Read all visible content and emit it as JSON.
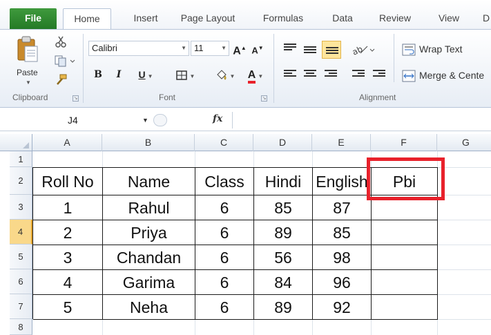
{
  "ribbon_tabs": [
    "File",
    "Home",
    "Insert",
    "Page Layout",
    "Formulas",
    "Data",
    "Review",
    "View",
    "D"
  ],
  "active_tab": "Home",
  "clipboard": {
    "paste_label": "Paste",
    "group_label": "Clipboard"
  },
  "font": {
    "family": "Calibri",
    "size": "11",
    "grow_label": "A",
    "shrink_label": "A",
    "bold": "B",
    "italic": "I",
    "underline": "U",
    "color_label": "A",
    "group_label": "Font"
  },
  "alignment": {
    "wrap_text": "Wrap Text",
    "merge_center": "Merge & Cente",
    "group_label": "Alignment"
  },
  "formula_bar": {
    "name_box": "J4",
    "fx": "fx",
    "value": ""
  },
  "sheet": {
    "columns": [
      "A",
      "B",
      "C",
      "D",
      "E",
      "F",
      "G"
    ],
    "row_numbers": [
      "1",
      "2",
      "3",
      "4",
      "5",
      "6",
      "7",
      "8"
    ],
    "selected_row": "4",
    "headers": [
      "Roll No",
      "Name",
      "Class",
      "Hindi",
      "English",
      "Pbi"
    ],
    "rows": [
      [
        "1",
        "Rahul",
        "6",
        "85",
        "87",
        ""
      ],
      [
        "2",
        "Priya",
        "6",
        "89",
        "85",
        ""
      ],
      [
        "3",
        "Chandan",
        "6",
        "56",
        "98",
        ""
      ],
      [
        "4",
        "Garima",
        "6",
        "84",
        "96",
        ""
      ],
      [
        "5",
        "Neha",
        "6",
        "89",
        "92",
        ""
      ]
    ]
  },
  "colors": {
    "file_tab": "#2e8b30",
    "highlight_box": "#e8212b",
    "font_color_bar": "#e8212b",
    "selected_row_header": "#f9d88a"
  },
  "icons": [
    "paste-icon",
    "cut-icon",
    "copy-icon",
    "format-painter-icon",
    "border-icon",
    "fill-color-icon",
    "orientation-icon",
    "wrap-text-icon",
    "merge-center-icon",
    "fx-icon",
    "select-all-icon"
  ]
}
